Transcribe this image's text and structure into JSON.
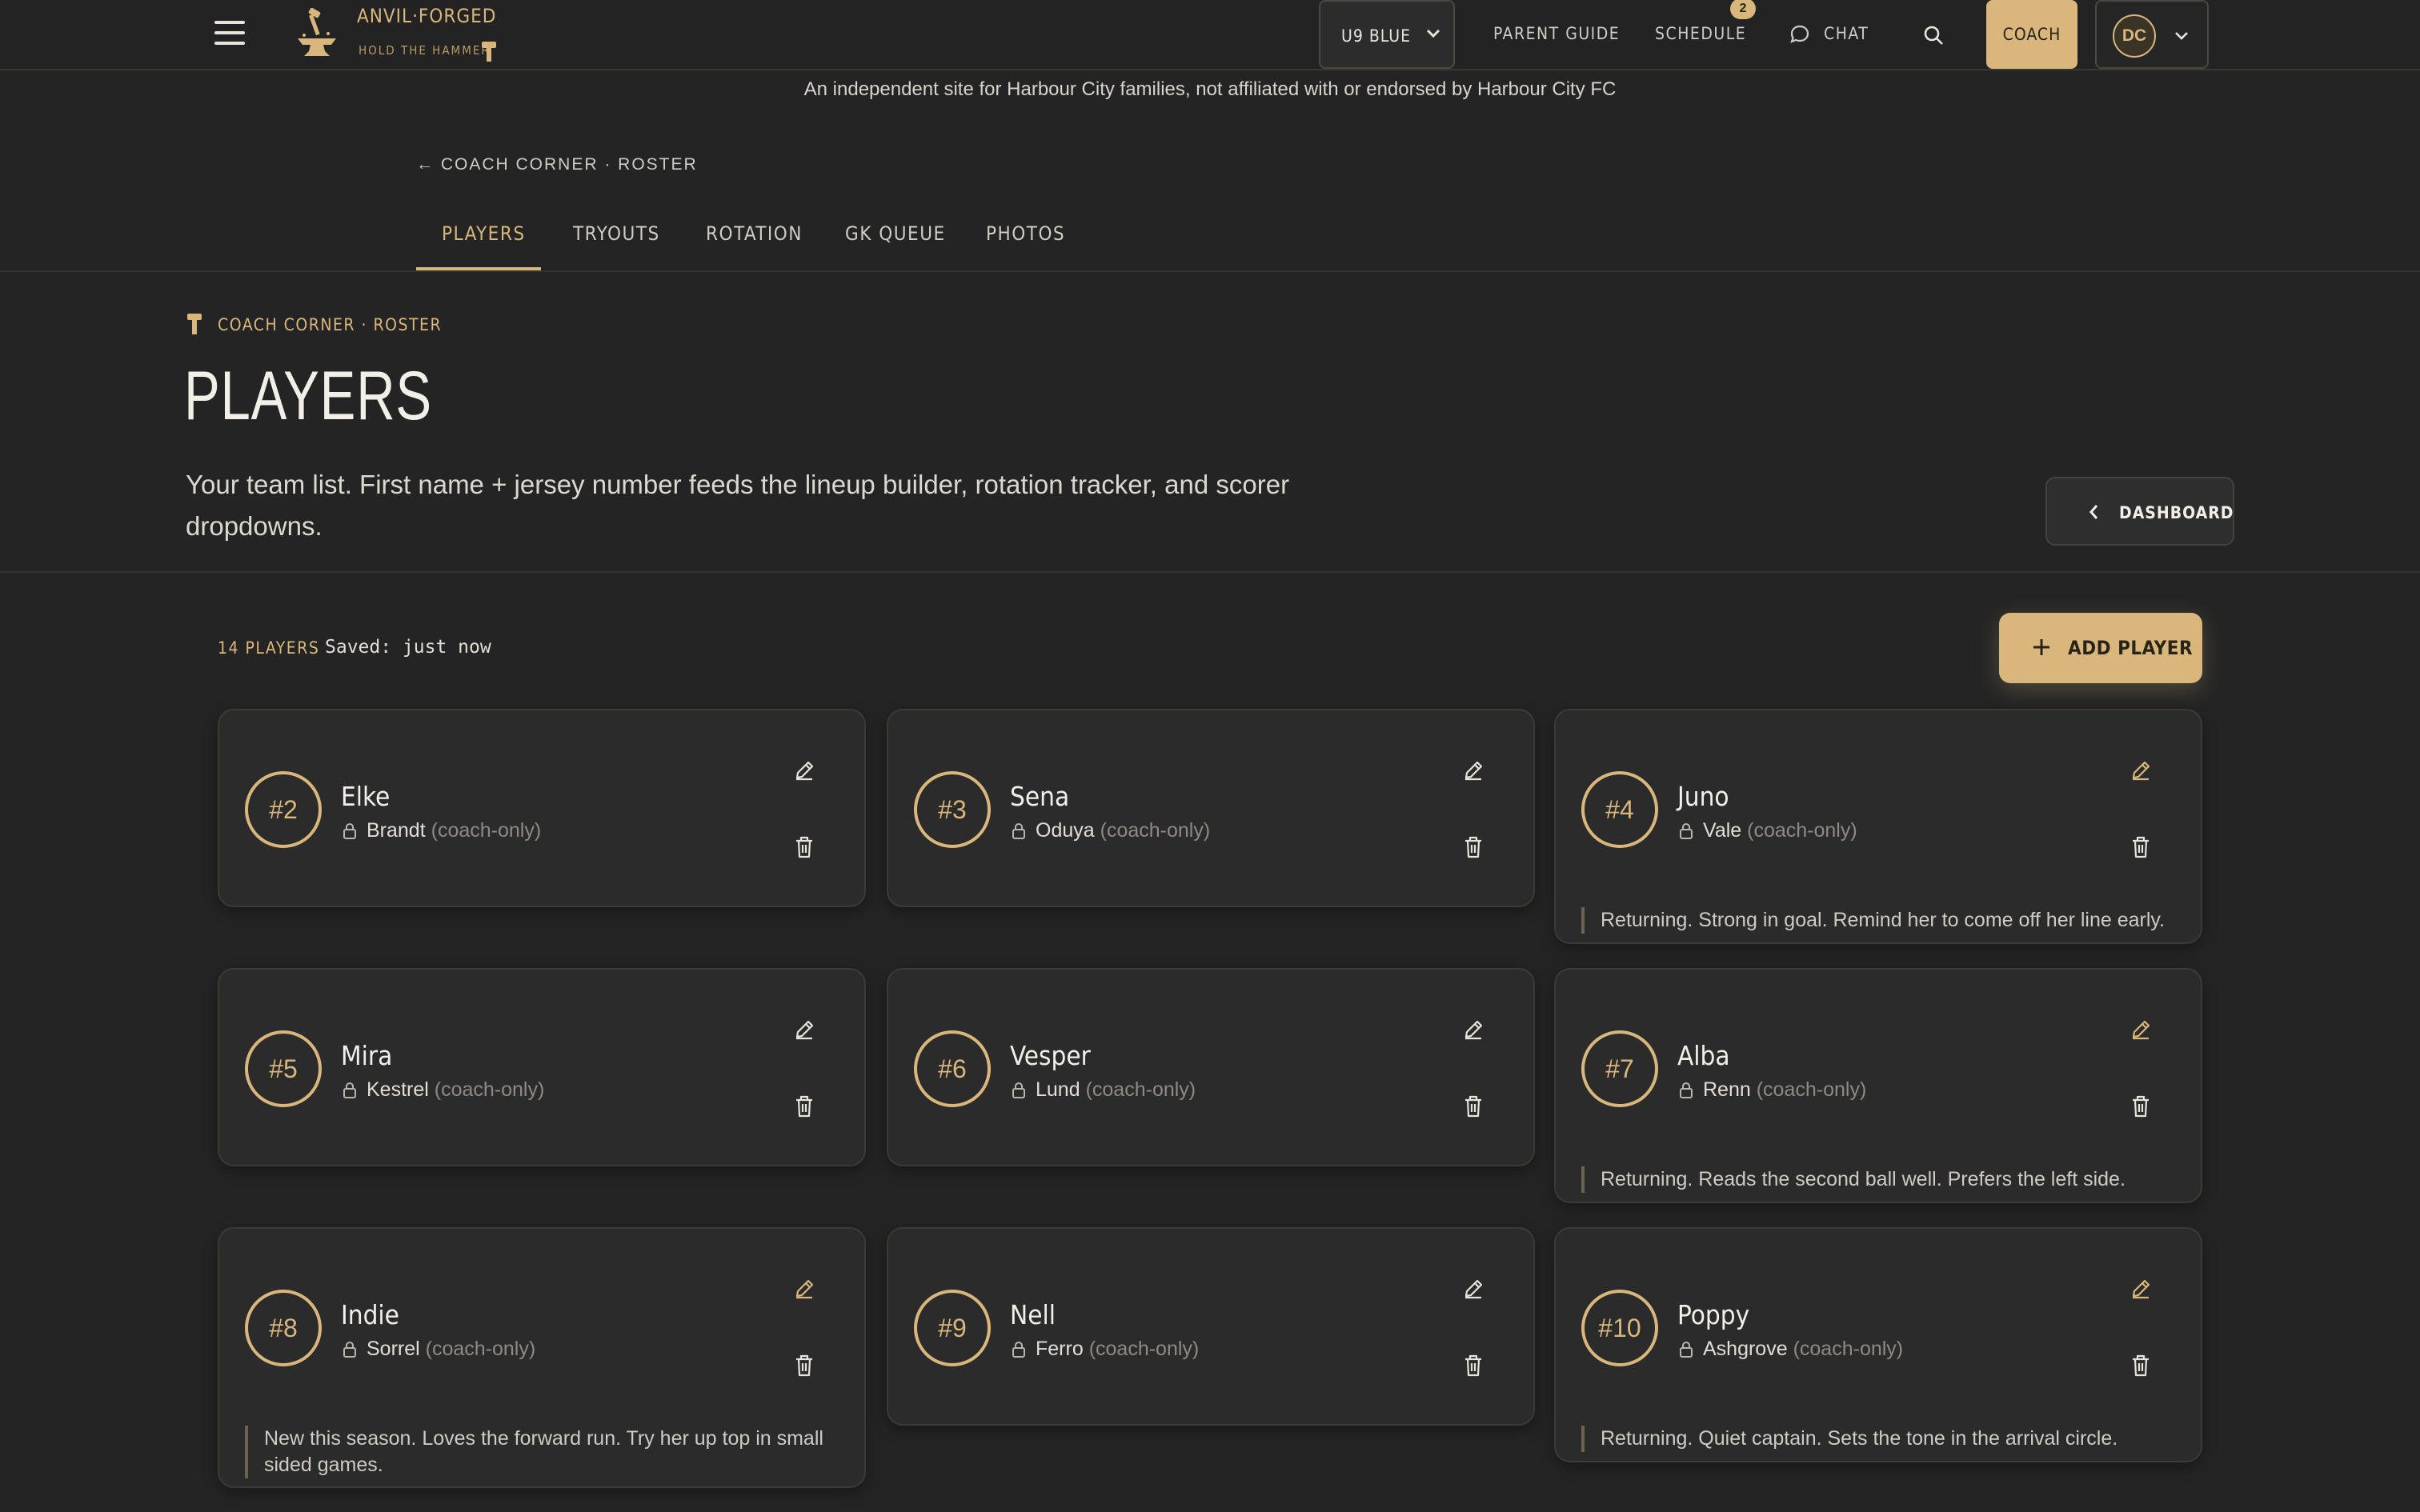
{
  "brand": {
    "title": "ANVIL·FORGED",
    "tagline": "HOLD THE HAMMER"
  },
  "nav": {
    "team": "U9 BLUE",
    "links": {
      "parent_guide": "PARENT GUIDE",
      "schedule": "SCHEDULE",
      "chat": "CHAT"
    },
    "schedule_badge": "2",
    "coach_label": "COACH",
    "avatar_initials": "DC"
  },
  "disclaimer": "An independent site for Harbour City families, not affiliated with or endorsed by Harbour City FC",
  "breadcrumb": "← COACH CORNER · ROSTER",
  "tabs": [
    "PLAYERS",
    "TRYOUTS",
    "ROTATION",
    "GK QUEUE",
    "PHOTOS"
  ],
  "header": {
    "eyebrow": "COACH CORNER · ROSTER",
    "title": "PLAYERS",
    "description": "Your team list. First name + jersey number feeds the lineup builder, rotation tracker, and scorer dropdowns.",
    "dashboard_label": "DASHBOARD"
  },
  "toolbar": {
    "count": "14 PLAYERS",
    "saved": "Saved: just now",
    "add_label": "ADD PLAYER"
  },
  "coach_only_label": "(coach-only)",
  "colors": {
    "accent": "#d9b77c",
    "background": "#242424",
    "card": "#2b2b2b"
  },
  "players": [
    {
      "jersey": "#2",
      "first": "Elke",
      "last": "Brandt",
      "note": ""
    },
    {
      "jersey": "#3",
      "first": "Sena",
      "last": "Oduya",
      "note": ""
    },
    {
      "jersey": "#4",
      "first": "Juno",
      "last": "Vale",
      "note": "Returning. Strong in goal. Remind her to come off her line early."
    },
    {
      "jersey": "#5",
      "first": "Mira",
      "last": "Kestrel",
      "note": ""
    },
    {
      "jersey": "#6",
      "first": "Vesper",
      "last": "Lund",
      "note": ""
    },
    {
      "jersey": "#7",
      "first": "Alba",
      "last": "Renn",
      "note": "Returning. Reads the second ball well. Prefers the left side."
    },
    {
      "jersey": "#8",
      "first": "Indie",
      "last": "Sorrel",
      "note": "New this season. Loves the forward run. Try her up top in small sided games."
    },
    {
      "jersey": "#9",
      "first": "Nell",
      "last": "Ferro",
      "note": ""
    },
    {
      "jersey": "#10",
      "first": "Poppy",
      "last": "Ashgrove",
      "note": "Returning. Quiet captain. Sets the tone in the arrival circle."
    }
  ]
}
